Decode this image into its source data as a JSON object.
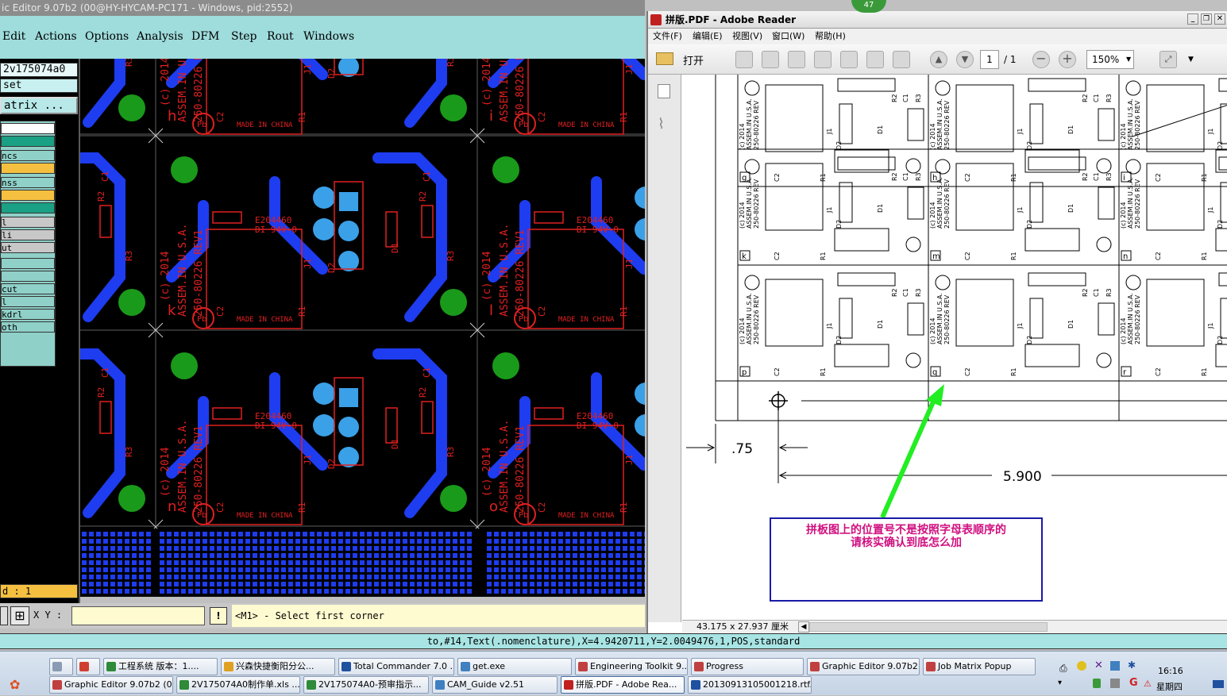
{
  "ge": {
    "title": "ic Editor 9.07b2 (00@HY-HYCAM-PC171 - Windows, pid:2552)",
    "menu": [
      "Edit",
      "Actions",
      "Options",
      "Analysis",
      "DFM",
      "Step",
      "Rout",
      "Windows"
    ],
    "job_name": "2v175074a0",
    "step_name": "set",
    "matrix_label": "atrix ...",
    "layers": [
      "",
      "",
      "ncs",
      "",
      "nss",
      "",
      "",
      "l",
      "li",
      "ut",
      "",
      "",
      "cut",
      "l",
      "kdrl",
      "oth"
    ],
    "layer_colors": [
      "#ffffff",
      "#1aa084",
      "#8fd0c8",
      "#f5c040",
      "#8fd0c8",
      "#f5c040",
      "#1aa084",
      "#c8c8c8",
      "#c8c8c8",
      "#c8c8c8",
      "#8fd0c8",
      "#8fd0c8",
      "#8fd0c8",
      "#8fd0c8",
      "#8fd0c8",
      "#8fd0c8"
    ],
    "status_field": "d : 1",
    "xy_label": "X Y :",
    "xy_value": "",
    "prompt": "<M1> - Select first corner",
    "statusline": "to,#14,Text(.nomenclature),X=4.9420711,Y=2.0049476,1,POS,standard",
    "board": {
      "row_letters": [
        [
          "h",
          "i"
        ],
        [
          "k",
          "l"
        ],
        [
          "n",
          "o"
        ]
      ],
      "fab_text": "E204460",
      "rating_text": "DI 94V-0",
      "copyright": "(c) 2014",
      "assembly": "ASSEM.IN U.S.A.",
      "part_no": "250-80226 REV1",
      "made_in": "MADE IN CHINA",
      "refdes": [
        "C1",
        "C2",
        "R1",
        "R2",
        "R3",
        "D1",
        "D2",
        "J1"
      ],
      "top_text": "ASSE",
      "top_text2": "250-8",
      "pb_label": "Pb"
    }
  },
  "ar": {
    "badge": "47",
    "title": "拼版.PDF - Adobe Reader",
    "menu": [
      "文件(F)",
      "编辑(E)",
      "视图(V)",
      "窗口(W)",
      "帮助(H)"
    ],
    "open_label": "打开",
    "page_current": "1",
    "page_total": "/ 1",
    "zoom": "150%",
    "page_size": "43.175 x 27.937 厘米",
    "row_labels": [
      [
        "g",
        "h",
        "i"
      ],
      [
        "k",
        "m",
        "n"
      ],
      [
        "p",
        "q",
        "r"
      ]
    ],
    "dim_small": ".75",
    "dim_large": "5.900",
    "annotation_line1": "拼板图上的位置号不是按照字母表顺序的",
    "annotation_line2": "请核实确认到底怎么加",
    "drawing_refdes": [
      "C1",
      "C2",
      "R1",
      "R2",
      "R3",
      "D1",
      "D2",
      "J1"
    ],
    "drawing_text": [
      "(c) 2014",
      "ASSEM.IN U.S.A.",
      "250-80226 REV"
    ]
  },
  "taskbar": {
    "row1": [
      {
        "label": "",
        "color": "#8a9bb4"
      },
      {
        "label": "",
        "color": "#d04030"
      },
      {
        "label": "工程系统  版本：1....",
        "color": "#2f8a3a"
      },
      {
        "label": "兴森快捷衡阳分公...",
        "color": "#e0a020"
      },
      {
        "label": "Total Commander 7.0 ...",
        "color": "#2050a0"
      },
      {
        "label": "get.exe",
        "color": "#4080c0"
      },
      {
        "label": "Engineering Toolkit 9....",
        "color": "#c04040"
      },
      {
        "label": "Progress",
        "color": "#c04040"
      },
      {
        "label": "Graphic Editor 9.07b2...",
        "color": "#c04040"
      },
      {
        "label": "Job Matrix Popup",
        "color": "#c04040"
      }
    ],
    "row2": [
      {
        "label": "",
        "color": "#e0a020"
      },
      {
        "label": "Graphic Editor 9.07b2 (0...",
        "color": "#c04040"
      },
      {
        "label": "2V175074A0制作单.xls ...",
        "color": "#2f8a3a"
      },
      {
        "label": "2V175074A0-预审指示...",
        "color": "#2f8a3a"
      },
      {
        "label": "CAM_Guide v2.51",
        "color": "#4080c0"
      },
      {
        "label": "拼版.PDF - Adobe Rea...",
        "color": "#c02020"
      },
      {
        "label": "20130913105001218.rtf...",
        "color": "#2050a0"
      }
    ],
    "clock_time": "16:16",
    "clock_day": "星期四"
  }
}
